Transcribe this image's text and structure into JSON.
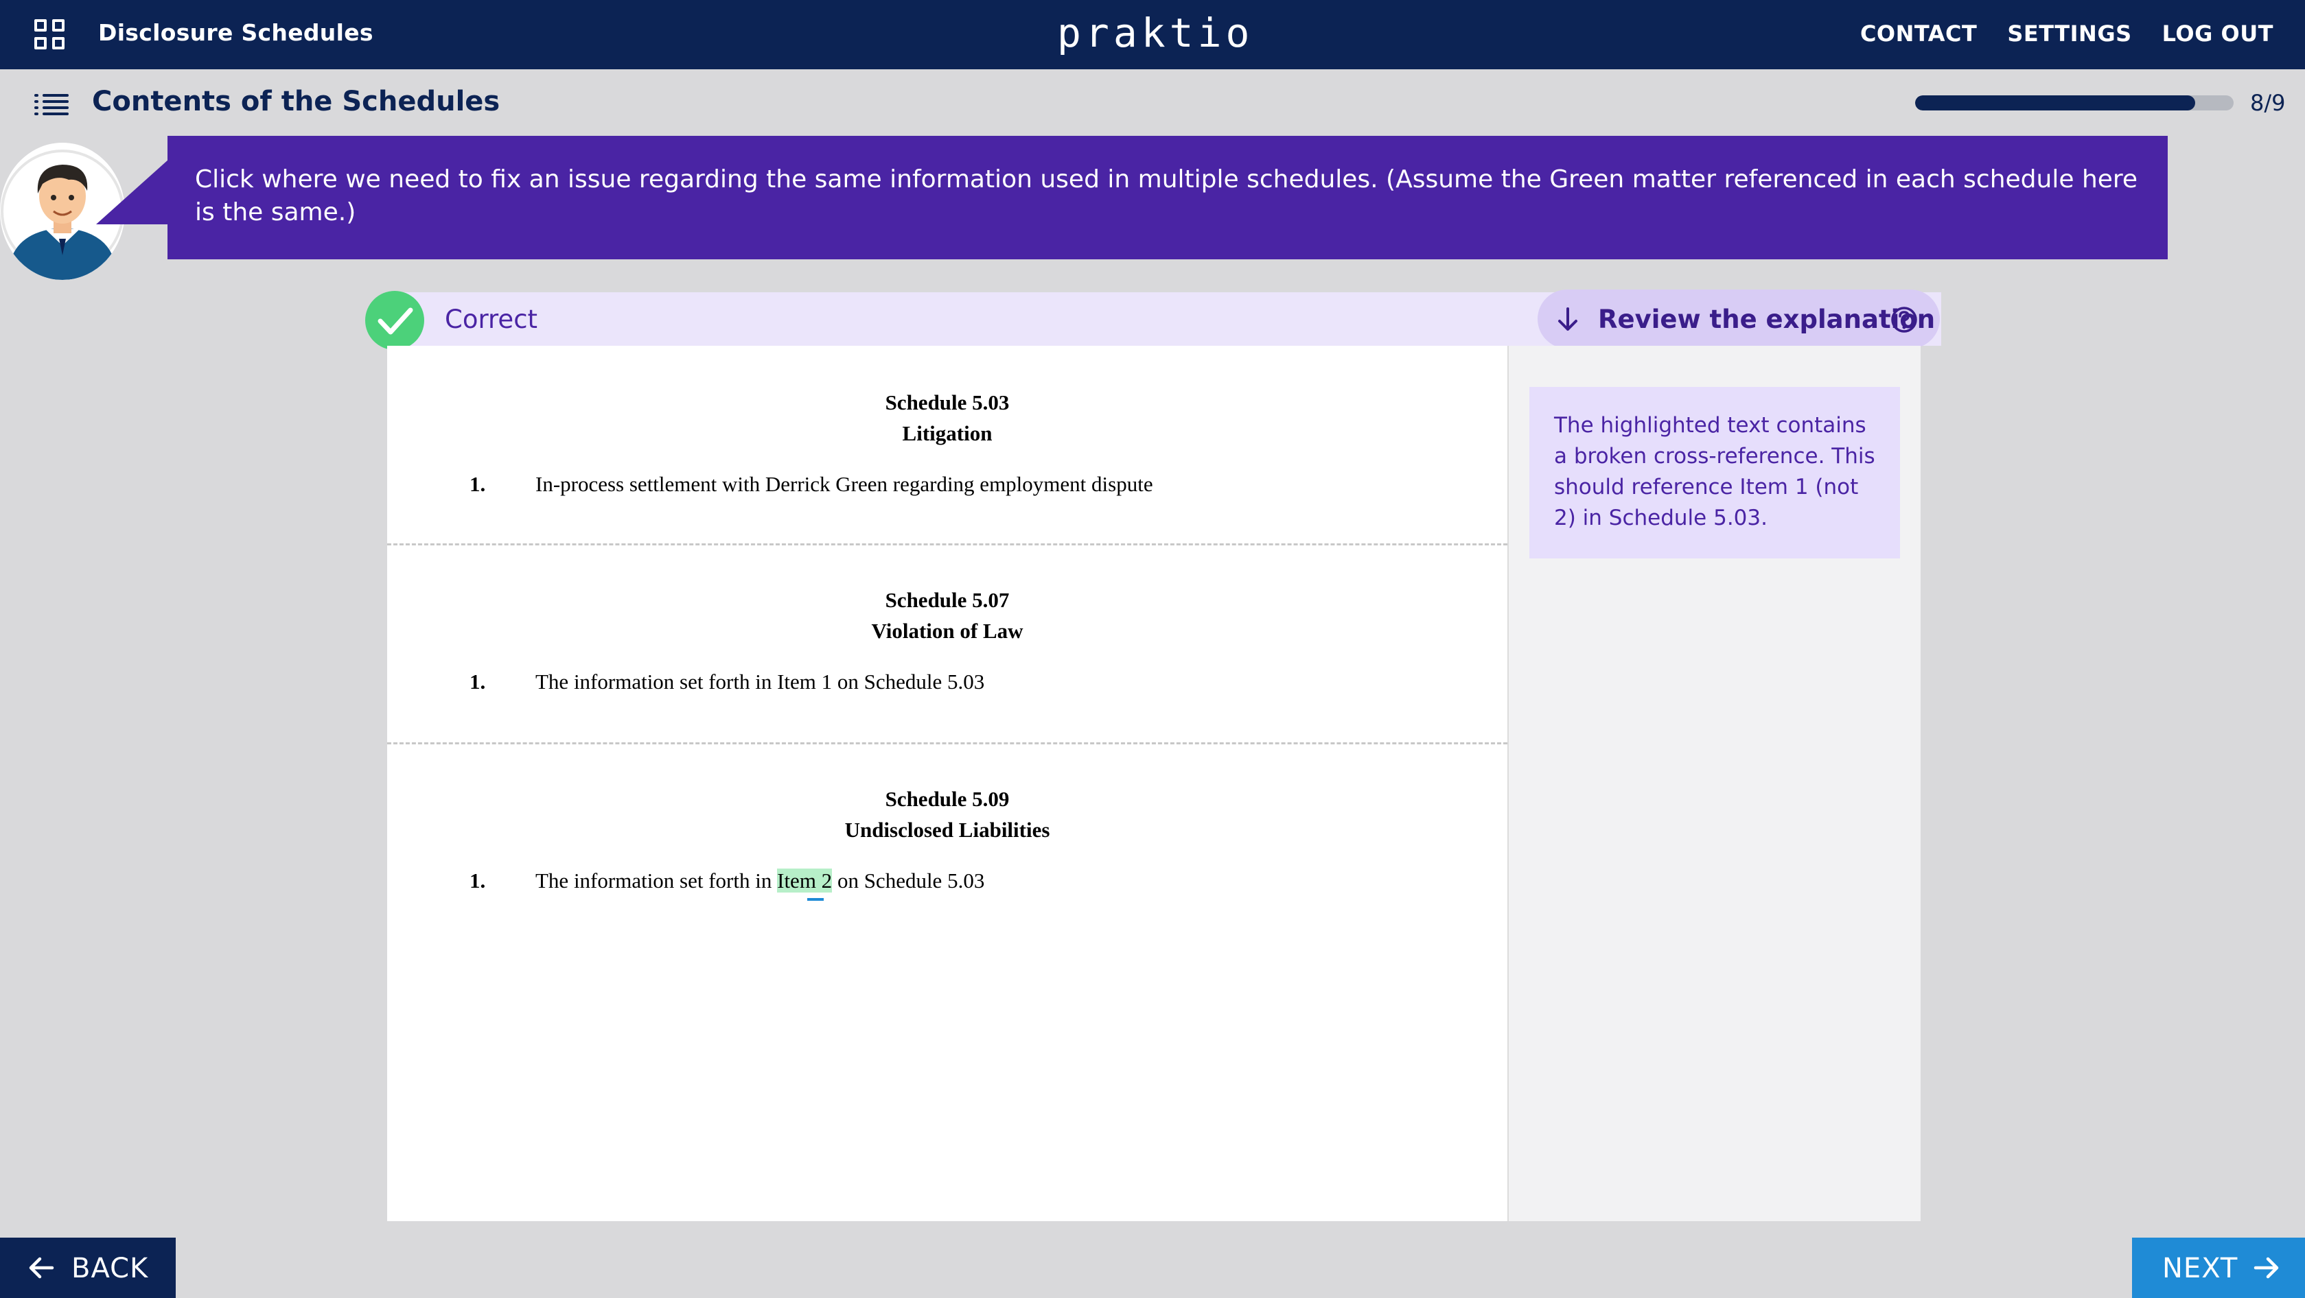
{
  "header": {
    "app_title": "Disclosure Schedules",
    "logo": "praktio",
    "nav": [
      "CONTACT",
      "SETTINGS",
      "LOG OUT"
    ]
  },
  "subheader": {
    "title": "Contents of the Schedules",
    "progress_text": "8/9",
    "progress_fraction": 0.88
  },
  "prompt": {
    "text": "Click where we need to fix an issue regarding the same information used in multiple schedules. (Assume the Green matter referenced in each schedule here is the same.)"
  },
  "result": {
    "status": "Correct",
    "review_label": "Review the explanation",
    "colors": {
      "correct": "#4cd17a",
      "accent": "#4a24a4"
    }
  },
  "schedules": [
    {
      "number": "Schedule 5.03",
      "title": "Litigation",
      "item_num": "1.",
      "item_text": "In-process settlement with Derrick Green regarding employment dispute"
    },
    {
      "number": "Schedule 5.07",
      "title": "Violation of Law",
      "item_num": "1.",
      "item_text": "The information set forth in Item 1 on Schedule 5.03"
    },
    {
      "number": "Schedule 5.09",
      "title": "Undisclosed Liabilities",
      "item_num": "1.",
      "item_text_before": "The information set forth in ",
      "item_text_highlight": "Item 2",
      "item_text_after": " on Schedule 5.03"
    }
  ],
  "explanation": {
    "text": "The highlighted text contains a broken cross-reference. This should reference Item 1 (not 2) in Schedule 5.03."
  },
  "footer": {
    "back_label": "BACK",
    "next_label": "NEXT"
  },
  "icons": [
    "apps-grid-icon",
    "list-menu-icon",
    "check-icon",
    "arrow-down-icon",
    "help-circle-icon",
    "arrow-left-icon",
    "arrow-right-icon",
    "avatar-icon"
  ]
}
